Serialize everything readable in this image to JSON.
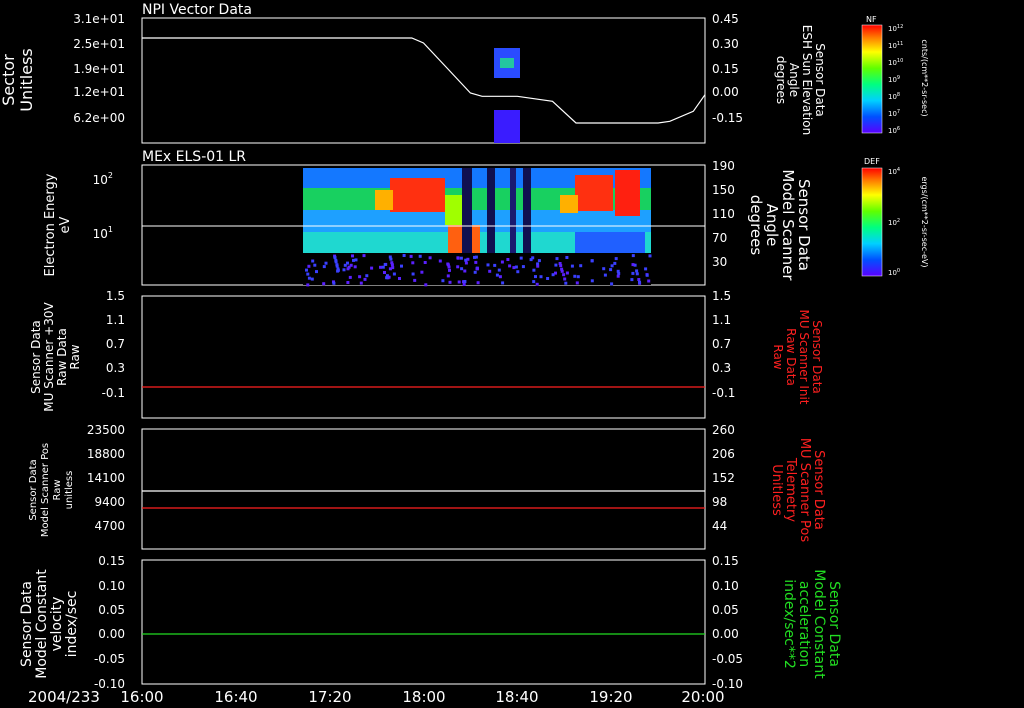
{
  "time_axis": {
    "start_label": "2004/233",
    "ticks": [
      "16:00",
      "16:40",
      "17:20",
      "18:00",
      "18:40",
      "19:20",
      "20:00"
    ]
  },
  "colors": {
    "white": "#ffffff",
    "red": "#ff2020",
    "green": "#22dd22"
  },
  "panels": [
    {
      "id": "npi",
      "title": "NPI Vector Data",
      "left_label": [
        "Sector",
        "Unitless"
      ],
      "left_ticks": [
        "3.1e+01",
        "2.5e+01",
        "1.9e+01",
        "1.2e+01",
        "6.2e+00"
      ],
      "right_label": [
        "Sensor Data",
        "ESH Sun Elevation",
        "Angle",
        "degrees"
      ],
      "right_ticks": [
        "0.45",
        "0.30",
        "0.15",
        "0.00",
        "-0.15"
      ]
    },
    {
      "id": "els",
      "title": "MEx ELS-01 LR",
      "left_label": [
        "Electron Energy",
        "eV"
      ],
      "left_ticks": [
        "10",
        "10"
      ],
      "left_tick_sup": [
        "2",
        "1"
      ],
      "right_label": [
        "Sensor Data",
        "Model Scanner",
        "Angle",
        "degrees"
      ],
      "right_ticks": [
        "190",
        "150",
        "110",
        "70",
        "30"
      ]
    },
    {
      "id": "mu30",
      "title": "",
      "left_label": [
        "Sensor Data",
        "MU Scanner +30V",
        "Raw Data",
        "Raw"
      ],
      "left_ticks": [
        "1.5",
        "1.1",
        "0.7",
        "0.3",
        "-0.1"
      ],
      "right_label": [
        "Sensor Data",
        "MU Scanner Init",
        "Raw Data",
        "Raw"
      ],
      "right_ticks": [
        "1.5",
        "1.1",
        "0.7",
        "0.3",
        "-0.1"
      ]
    },
    {
      "id": "pos",
      "title": "",
      "left_label": [
        "Sensor Data",
        "Model Scanner Pos",
        "Raw",
        "unitless"
      ],
      "left_ticks": [
        "23500",
        "18800",
        "14100",
        "9400",
        "4700"
      ],
      "right_label": [
        "Sensor Data",
        "MU Scanner Pos",
        "Telemetry",
        "Unitless"
      ],
      "right_ticks": [
        "260",
        "206",
        "152",
        "98",
        "44"
      ]
    },
    {
      "id": "vel",
      "title": "",
      "left_label": [
        "Sensor Data",
        "Model Constant",
        "velocity",
        "index/sec"
      ],
      "left_ticks": [
        "0.15",
        "0.10",
        "0.05",
        "0.00",
        "-0.05",
        "-0.10"
      ],
      "right_label": [
        "Sensor Data",
        "Model Constant",
        "acceleration",
        "index/sec**2"
      ],
      "right_ticks": [
        "0.15",
        "0.10",
        "0.05",
        "0.00",
        "-0.05",
        "-0.10"
      ]
    }
  ],
  "colorbars": [
    {
      "id": "nf",
      "title": "NF",
      "unit": "cnts/(cm**2-sr-sec)",
      "ticks": [
        "10",
        "10",
        "10",
        "10",
        "10",
        "10",
        "10"
      ],
      "tick_sup": [
        "12",
        "11",
        "10",
        "9",
        "8",
        "7",
        "6"
      ]
    },
    {
      "id": "def",
      "title": "DEF",
      "unit": "ergs/(cm**2-sr-sec-eV)",
      "ticks": [
        "10",
        "10",
        "10"
      ],
      "tick_sup": [
        "4",
        "2",
        "0"
      ]
    }
  ],
  "chart_data": [
    {
      "type": "line",
      "title": "NPI Vector Data",
      "series": [
        {
          "axis": "right",
          "color": "#ffffff",
          "x": [
            "16:00",
            "17:50",
            "17:55",
            "18:00",
            "18:10",
            "18:20",
            "18:25",
            "18:40",
            "18:55",
            "19:05",
            "19:20",
            "19:40",
            "19:45",
            "19:55",
            "20:00"
          ],
          "y": [
            0.33,
            0.33,
            0.33,
            0.3,
            0.15,
            0.0,
            -0.02,
            -0.02,
            -0.05,
            -0.18,
            -0.18,
            -0.18,
            -0.17,
            -0.11,
            -0.01
          ]
        }
      ],
      "image_blocks": [
        {
          "t_start": "18:30",
          "t_end": "18:39",
          "sector_range": [
            17,
            24
          ],
          "level": "mid"
        },
        {
          "t_start": "18:30",
          "t_end": "18:39",
          "sector_range": [
            0,
            6
          ],
          "level": "low"
        }
      ],
      "left_ylim": [
        0,
        31
      ],
      "right_ylim": [
        -0.3,
        0.45
      ]
    },
    {
      "type": "heatmap",
      "title": "MEx ELS-01 LR",
      "x_range": [
        "17:00",
        "19:45"
      ],
      "ylabel": "Electron Energy",
      "y_scale": "log",
      "ylim": [
        1,
        200
      ],
      "white_line": {
        "axis": "right",
        "y": 83
      }
    },
    {
      "type": "line",
      "series": [
        {
          "axis": "left",
          "color": "#ff2020",
          "y": 0.0
        }
      ],
      "ylim": [
        -0.5,
        1.5
      ]
    },
    {
      "type": "line",
      "series": [
        {
          "axis": "left",
          "color": "#ffffff",
          "y": 11400
        },
        {
          "axis": "left",
          "color": "#ff2020",
          "y": 8800
        }
      ],
      "left_ylim": [
        0,
        23500
      ],
      "right_ylim": [
        0,
        260
      ]
    },
    {
      "type": "line",
      "series": [
        {
          "axis": "left",
          "color": "#22dd22",
          "y": 0.0
        }
      ],
      "ylim": [
        -0.1,
        0.15
      ]
    }
  ]
}
